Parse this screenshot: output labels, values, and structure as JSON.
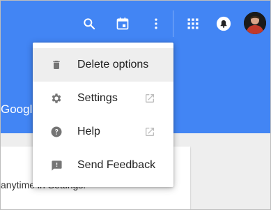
{
  "header": {
    "brand_fragment": "Googl",
    "icons": [
      "search-icon",
      "calendar-icon",
      "more-vert-icon",
      "apps-grid-icon",
      "notifications-icon",
      "avatar"
    ]
  },
  "menu": {
    "items": [
      {
        "label": "Delete options",
        "icon": "trash-icon",
        "external": false
      },
      {
        "label": "Settings",
        "icon": "gear-icon",
        "external": true
      },
      {
        "label": "Help",
        "icon": "help-icon",
        "external": true
      },
      {
        "label": "Send Feedback",
        "icon": "feedback-icon",
        "external": false
      }
    ]
  },
  "card": {
    "text": "anytime in Settings."
  },
  "colors": {
    "appbar": "#4285f4",
    "menu_icon": "#757575",
    "external_icon": "#bdbdbd"
  }
}
